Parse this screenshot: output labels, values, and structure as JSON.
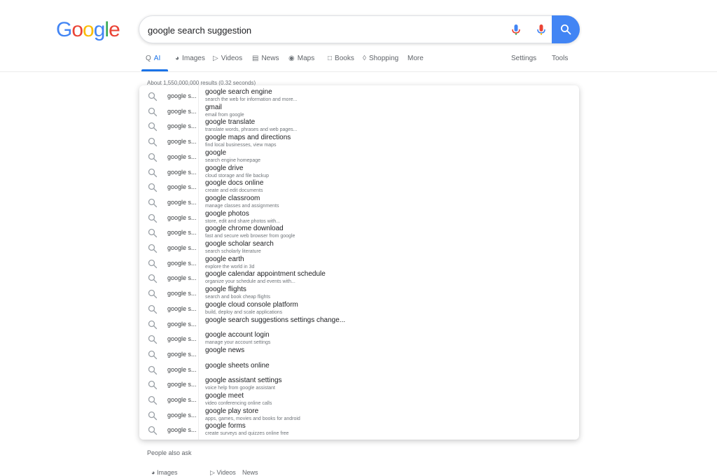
{
  "logo": {
    "letters": [
      "G",
      "o",
      "o",
      "g",
      "l",
      "e"
    ]
  },
  "search": {
    "value": "google search suggestion",
    "placeholder": ""
  },
  "icons": {
    "mic": "mic-icon",
    "lens": "voice-icon",
    "search": "search-icon",
    "suggestion": "search-icon"
  },
  "colors": {
    "brand_blue": "#4285F4",
    "brand_red": "#EA4335",
    "brand_yellow": "#FBBC05",
    "brand_green": "#34A853",
    "tab_active": "#1a73e8"
  },
  "tabs": [
    {
      "label": "AI"
    },
    {
      "label": "Images"
    },
    {
      "label": "Videos"
    },
    {
      "label": "News"
    },
    {
      "label": "Maps"
    },
    {
      "label": "Books"
    },
    {
      "label": "Shopping"
    },
    {
      "label": "More"
    }
  ],
  "tools": {
    "settings": "Settings",
    "tools": "Tools"
  },
  "result_stats": "About 1,550,000,000 results (0.32 seconds)",
  "suggestions_left": [
    "google s...",
    "google s...",
    "google s...",
    "google s...",
    "google s...",
    "google s...",
    "google s...",
    "google s...",
    "google s...",
    "google s...",
    "google s...",
    "google s...",
    "google s...",
    "google s...",
    "google s...",
    "google s...",
    "google s...",
    "google s...",
    "google s...",
    "google s...",
    "google s...",
    "google s...",
    "google s...",
    "google s..."
  ],
  "suggestions": [
    {
      "main": "google search engine",
      "sub": "search the web for information and more..."
    },
    {
      "main": "gmail",
      "sub": "email from google"
    },
    {
      "main": "google translate",
      "sub": "translate words, phrases and web pages..."
    },
    {
      "main": "google maps and directions",
      "sub": "find local businesses, view maps"
    },
    {
      "main": "google",
      "sub": "search engine homepage"
    },
    {
      "main": "google drive",
      "sub": "cloud storage and file backup"
    },
    {
      "main": "google docs online",
      "sub": "create and edit documents"
    },
    {
      "main": "google classroom",
      "sub": "manage classes and assignments"
    },
    {
      "main": "google photos",
      "sub": "store, edit and share photos with..."
    },
    {
      "main": "google chrome download",
      "sub": "fast and secure web browser from google"
    },
    {
      "main": "google scholar search",
      "sub": "search scholarly literature"
    },
    {
      "main": "google earth",
      "sub": "explore the world in 3d"
    },
    {
      "main": "google calendar appointment schedule",
      "sub": "organize your schedule and events with..."
    },
    {
      "main": "google flights",
      "sub": "search and book cheap flights"
    },
    {
      "main": "google cloud console platform",
      "sub": "build, deploy and scale applications"
    },
    {
      "main": "google search suggestions settings change...",
      "sub": ""
    },
    {
      "main": "google account login",
      "sub": "manage your account settings"
    },
    {
      "main": "google news",
      "sub": ""
    },
    {
      "main": "google sheets online",
      "sub": ""
    },
    {
      "main": "google assistant settings",
      "sub": "voice help from google assistant"
    },
    {
      "main": "google meet",
      "sub": "video conferencing online calls"
    },
    {
      "main": "google play store",
      "sub": "apps, games, movies and books for android"
    },
    {
      "main": "google forms",
      "sub": "create surveys and quizzes online free"
    }
  ],
  "below": {
    "title": "People also ask",
    "items": [
      "Images",
      "Videos",
      "News"
    ]
  }
}
